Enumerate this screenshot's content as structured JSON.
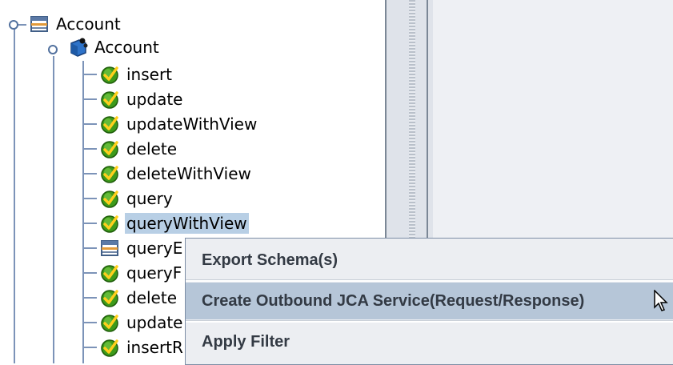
{
  "tree": {
    "root_label": "Account",
    "child_label": "Account",
    "operations": [
      {
        "label": "insert",
        "icon": "check-icon"
      },
      {
        "label": "update",
        "icon": "check-icon"
      },
      {
        "label": "updateWithView",
        "icon": "check-icon"
      },
      {
        "label": "delete",
        "icon": "check-icon"
      },
      {
        "label": "deleteWithView",
        "icon": "check-icon"
      },
      {
        "label": "query",
        "icon": "check-icon"
      },
      {
        "label": "queryWithView",
        "icon": "check-icon",
        "selected": true
      },
      {
        "label": "queryE",
        "icon": "table-icon"
      },
      {
        "label": "queryF",
        "icon": "check-icon"
      },
      {
        "label": "delete",
        "icon": "check-icon"
      },
      {
        "label": "update",
        "icon": "check-icon"
      },
      {
        "label": "insertR",
        "icon": "check-icon"
      }
    ]
  },
  "context_menu": {
    "items": [
      {
        "label": "Export Schema(s)"
      },
      {
        "label": "Create Outbound JCA Service(Request/Response)",
        "highlighted": true
      },
      {
        "label": "Apply Filter"
      }
    ]
  },
  "colors": {
    "selection": "#b8cfe5",
    "menu_highlight": "#b6c6d8",
    "check_green": "#3d9a1a",
    "guide_line": "#7c93b8"
  }
}
